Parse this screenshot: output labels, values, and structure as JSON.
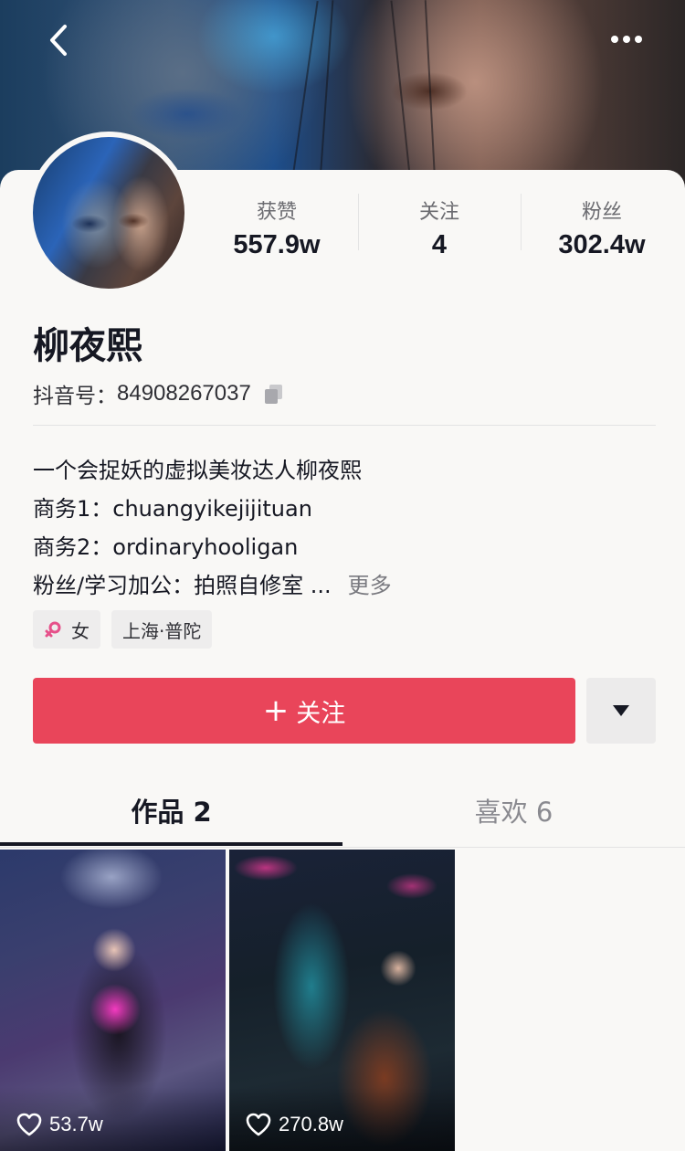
{
  "header": {
    "back_icon": "chevron-left-icon",
    "more_icon": "more-dots-icon"
  },
  "profile": {
    "name": "柳夜熙",
    "uid_label": "抖音号：",
    "uid_value": "84908267037",
    "stats": [
      {
        "label": "获赞",
        "value": "557.9w"
      },
      {
        "label": "关注",
        "value": "4"
      },
      {
        "label": "粉丝",
        "value": "302.4w"
      }
    ],
    "bio": [
      "一个会捉妖的虚拟美妆达人柳夜熙",
      "商务1：chuangyikejijituan",
      "商务2：ordinaryhooligan",
      "粉丝/学习加公：拍照自修室 ..."
    ],
    "bio_more": "更多",
    "tags": [
      {
        "label": "女",
        "icon": "female-icon"
      },
      {
        "label": "上海·普陀"
      }
    ]
  },
  "actions": {
    "follow_label": "关注",
    "follow_color": "#e9455a",
    "dropdown_icon": "caret-down-icon"
  },
  "tabs": [
    {
      "label": "作品 2",
      "active": true
    },
    {
      "label": "喜欢 6",
      "active": false
    }
  ],
  "videos": [
    {
      "likes": "53.7w"
    },
    {
      "likes": "270.8w"
    }
  ]
}
